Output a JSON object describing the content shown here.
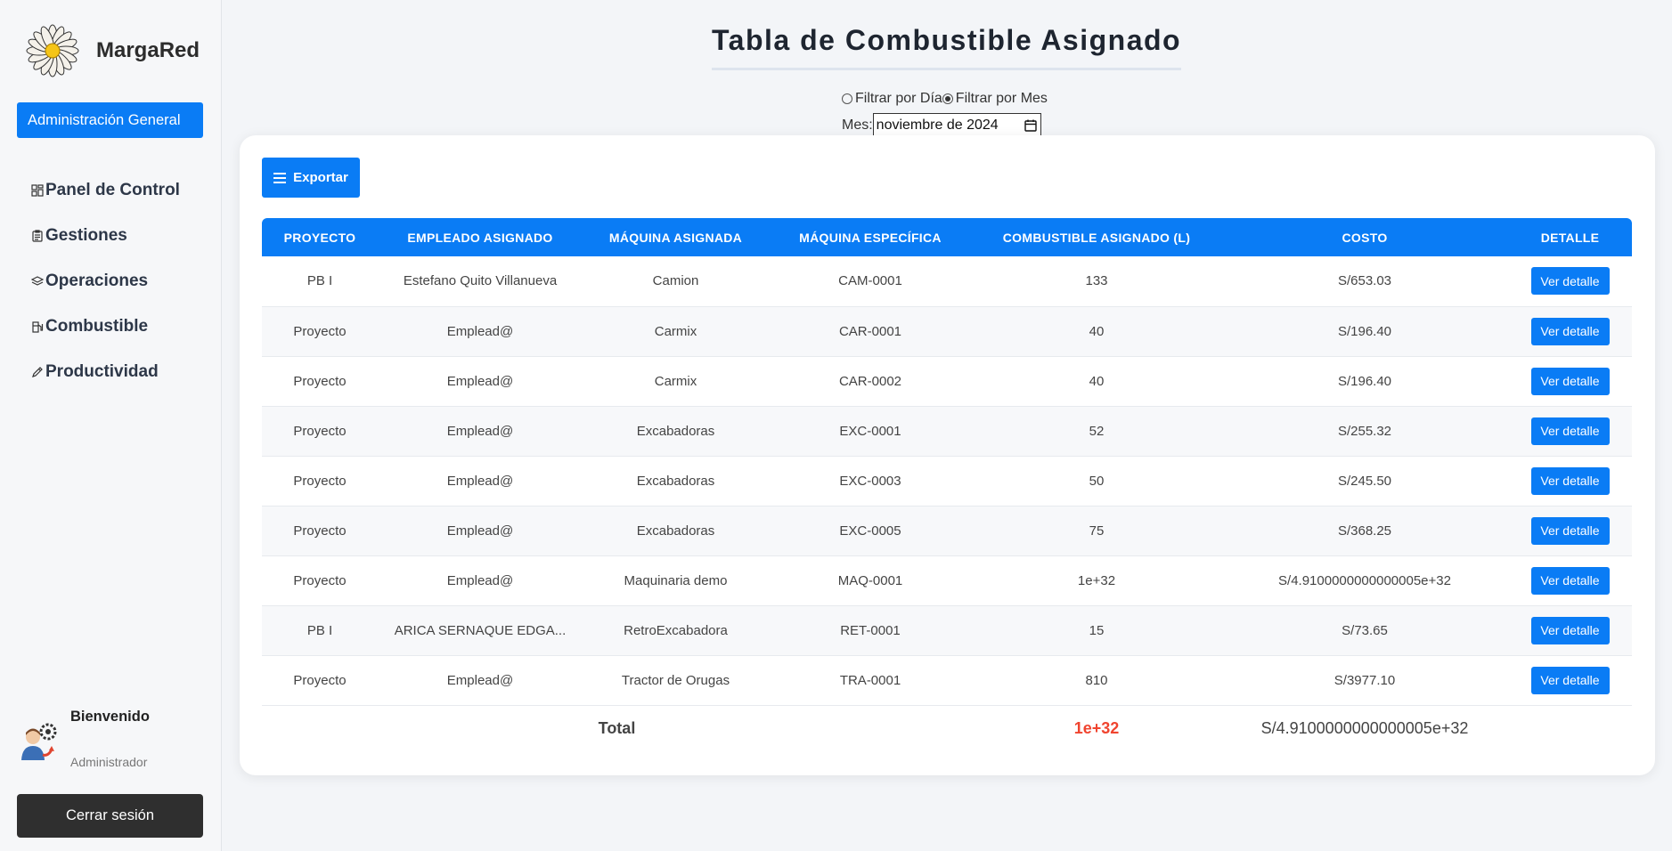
{
  "app": {
    "name": "MargaRed"
  },
  "sidebar": {
    "admin_button": "Administración General",
    "items": [
      {
        "label": "Panel de Control",
        "icon": "dashboard-icon"
      },
      {
        "label": "Gestiones",
        "icon": "clipboard-icon"
      },
      {
        "label": "Operaciones",
        "icon": "layers-icon"
      },
      {
        "label": "Combustible",
        "icon": "fuel-pump-icon"
      },
      {
        "label": "Productividad",
        "icon": "pencil-icon"
      }
    ],
    "user": {
      "greeting": "Bienvenido",
      "role": "Administrador"
    },
    "logout": "Cerrar sesión"
  },
  "page": {
    "title": "Tabla de Combustible Asignado"
  },
  "filters": {
    "by_day": "Filtrar por Día",
    "by_month": "Filtrar por Mes",
    "selected": "month",
    "month_label": "Mes:",
    "month_value": "noviembre de 2024"
  },
  "toolbar": {
    "export_label": "Exportar"
  },
  "table": {
    "headers": [
      "Proyecto",
      "Empleado Asignado",
      "Máquina Asignada",
      "Máquina Específica",
      "Combustible Asignado (L)",
      "Costo",
      "Detalle"
    ],
    "detail_label": "Ver detalle",
    "rows": [
      [
        "PB I",
        "Estefano Quito Villanueva",
        "Camion",
        "CAM-0001",
        "133",
        "S/653.03"
      ],
      [
        "Proyecto",
        "Emplead@",
        "Carmix",
        "CAR-0001",
        "40",
        "S/196.40"
      ],
      [
        "Proyecto",
        "Emplead@",
        "Carmix",
        "CAR-0002",
        "40",
        "S/196.40"
      ],
      [
        "Proyecto",
        "Emplead@",
        "Excabadoras",
        "EXC-0001",
        "52",
        "S/255.32"
      ],
      [
        "Proyecto",
        "Emplead@",
        "Excabadoras",
        "EXC-0003",
        "50",
        "S/245.50"
      ],
      [
        "Proyecto",
        "Emplead@",
        "Excabadoras",
        "EXC-0005",
        "75",
        "S/368.25"
      ],
      [
        "Proyecto",
        "Emplead@",
        "Maquinaria demo",
        "MAQ-0001",
        "1e+32",
        "S/4.9100000000000005e+32"
      ],
      [
        "PB I",
        "ARICA SERNAQUE EDGA...",
        "RetroExcabadora",
        "RET-0001",
        "15",
        "S/73.65"
      ],
      [
        "Proyecto",
        "Emplead@",
        "Tractor de Orugas",
        "TRA-0001",
        "810",
        "S/3977.10"
      ]
    ],
    "footer": {
      "label": "Total",
      "fuel": "1e+32",
      "cost": "S/4.9100000000000005e+32"
    }
  },
  "colors": {
    "primary": "#0a7cf5",
    "total_fuel": "#f0442f",
    "logout": "#2f2f2f"
  }
}
